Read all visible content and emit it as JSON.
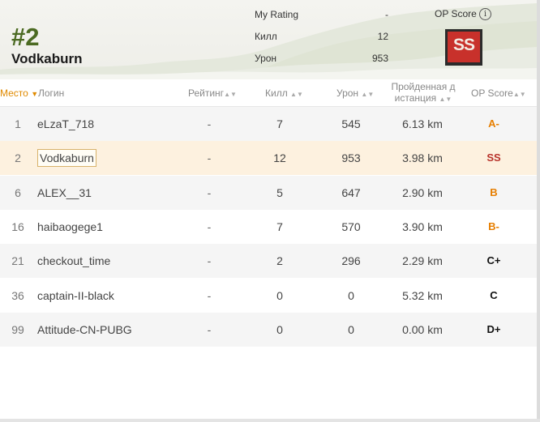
{
  "header": {
    "rank": "#2",
    "player_name": "Vodkaburn",
    "stats": [
      {
        "label": "My Rating",
        "value": "-"
      },
      {
        "label": "Килл",
        "value": "12"
      },
      {
        "label": "Урон",
        "value": "953"
      }
    ],
    "op_score_label": "OP Score",
    "info_icon": "i",
    "op_badge": "SS"
  },
  "columns": {
    "place": "Место",
    "login": "Логин",
    "rating": "Рейтинг",
    "kills": "Килл",
    "damage": "Урон",
    "distance_line1": "Пройденная д",
    "distance_line2": "истанция",
    "op_score": "OP Score"
  },
  "rows": [
    {
      "place": "1",
      "login": "eLzaT_718",
      "rating": "-",
      "kills": "7",
      "damage": "545",
      "distance": "6.13 km",
      "op": "A-"
    },
    {
      "place": "2",
      "login": "Vodkaburn",
      "rating": "-",
      "kills": "12",
      "damage": "953",
      "distance": "3.98 km",
      "op": "SS"
    },
    {
      "place": "6",
      "login": "ALEX__31",
      "rating": "-",
      "kills": "5",
      "damage": "647",
      "distance": "2.90 km",
      "op": "B"
    },
    {
      "place": "16",
      "login": "haibaogege1",
      "rating": "-",
      "kills": "7",
      "damage": "570",
      "distance": "3.90 km",
      "op": "B-"
    },
    {
      "place": "21",
      "login": "checkout_time",
      "rating": "-",
      "kills": "2",
      "damage": "296",
      "distance": "2.29 km",
      "op": "C+"
    },
    {
      "place": "36",
      "login": "captain-II-black",
      "rating": "-",
      "kills": "0",
      "damage": "0",
      "distance": "5.32 km",
      "op": "C"
    },
    {
      "place": "99",
      "login": "Attitude-CN-PUBG",
      "rating": "-",
      "kills": "0",
      "damage": "0",
      "distance": "0.00 km",
      "op": "D+"
    }
  ],
  "colors": {
    "rank_green": "#4b6a22",
    "highlight_row": "#fdf1df",
    "sort_active": "#e08a00",
    "grade_orange": "#e67e00",
    "grade_red": "#b8332b",
    "grade_dark": "#111111"
  }
}
